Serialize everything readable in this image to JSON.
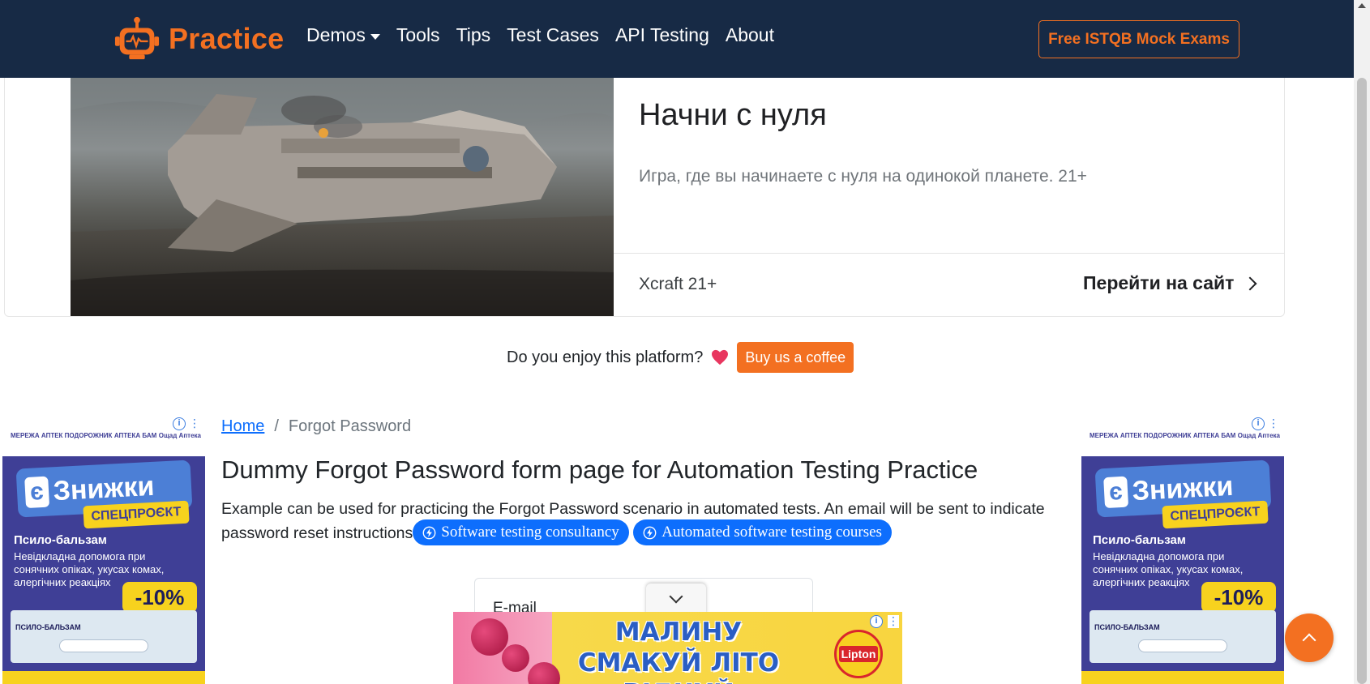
{
  "navbar": {
    "brand": "Practice",
    "links": [
      "Demos",
      "Tools",
      "Tips",
      "Test Cases",
      "API Testing",
      "About"
    ],
    "cta": "Free ISTQB Mock Exams"
  },
  "top_ad": {
    "title": "Начни с нуля",
    "description": "Игра, где вы начинаете с нуля на одинокой планете. 21+",
    "brand": "Xcraft 21+",
    "cta": "Перейти на сайт"
  },
  "coffee": {
    "text": "Do you enjoy this platform?",
    "button": "Buy us a coffee"
  },
  "breadcrumb": {
    "home": "Home",
    "separator": "/",
    "current": "Forgot Password"
  },
  "main": {
    "title": "Dummy Forgot Password form page for Automation Testing Practice",
    "description": "Example can be used for practicing the Forgot Password scenario in automated tests. An email will be sent to indicate password reset instructions",
    "pills": [
      "Software testing consultancy",
      "Automated software testing courses"
    ],
    "email_label": "E-mail"
  },
  "side_ad": {
    "logo1": "МЕРЕЖА АПТЕК ПОДОРОЖНИК",
    "logo2": "АПТЕКА БАМ",
    "logo3": "Ощад Аптека",
    "e_badge": "є",
    "headline": "Знижки",
    "sub": "СПЕЦПРОЄКТ",
    "product": "Псило-бальзам",
    "product_desc": "Невідкладна допомога при сонячних опіках, укусах комах, алергічних реакціях",
    "discount": "-10%",
    "pack_label": "ПСИЛО-БАЛЬЗАМ"
  },
  "bottom_ad": {
    "headline": "МАЛИНУ СМАКУЙ ЛІТО ВІДЧУЙ",
    "brand": "Lipton"
  },
  "colors": {
    "navbar_bg": "#172a45",
    "accent": "#f37021",
    "link": "#0d6efd"
  },
  "icons": [
    "robot-logo-icon",
    "caret-down-icon",
    "chevron-right-icon",
    "heart-icon",
    "bolt-icon",
    "chevron-down-icon",
    "chevron-up-icon",
    "ad-info-icon",
    "ad-menu-icon"
  ]
}
